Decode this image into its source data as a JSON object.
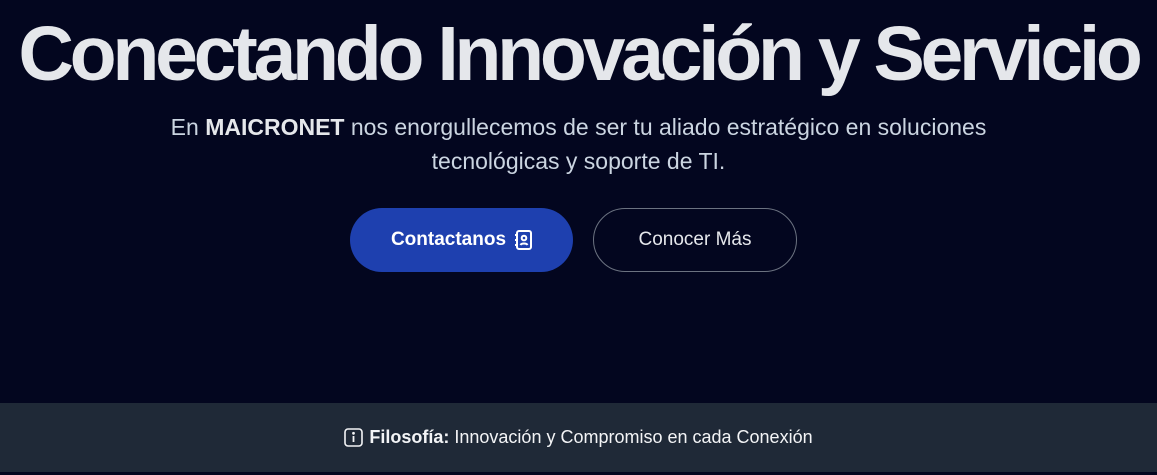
{
  "hero": {
    "title": "Conectando Innovación y Servicio",
    "subtitle_prefix": "En",
    "brand": "MAICRONET",
    "subtitle_line1_rest": "nos enorgullecemos de ser tu aliado estratégico en soluciones",
    "subtitle_line2": "tecnológicas y soporte de TI."
  },
  "buttons": {
    "contact_label": "Contactanos",
    "contact_icon": "address-book-icon",
    "more_label": "Conocer Más"
  },
  "footer": {
    "icon": "info-icon",
    "label": "Filosofía:",
    "text": "Innovación y Compromiso en cada Conexión"
  },
  "colors": {
    "background": "#03061f",
    "primary": "#1e40af",
    "band": "#1f2937"
  }
}
